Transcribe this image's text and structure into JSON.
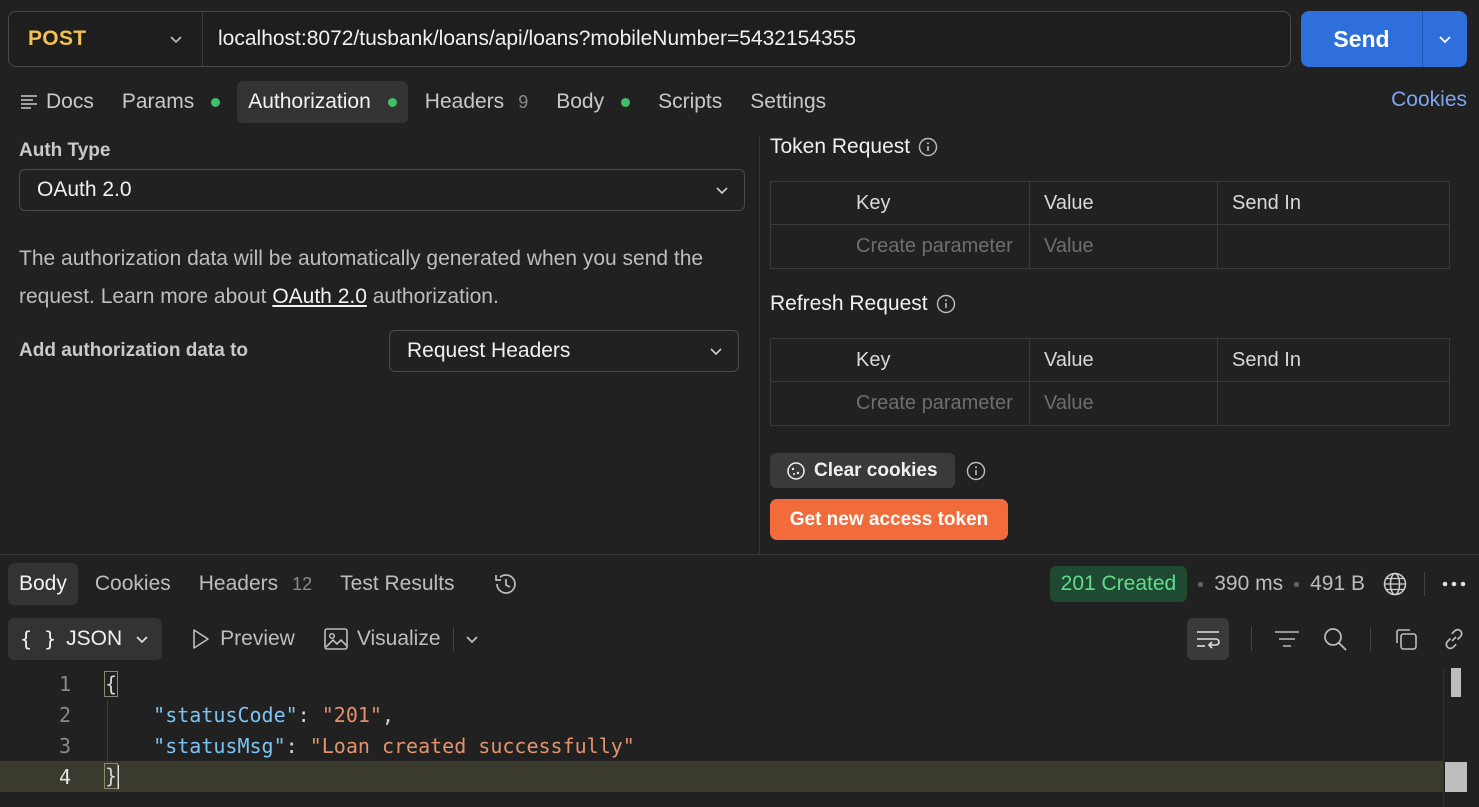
{
  "request": {
    "method": "POST",
    "url": "localhost:8072/tusbank/loans/api/loans?mobileNumber=5432154355",
    "send_label": "Send"
  },
  "tabs": [
    {
      "label": "Docs"
    },
    {
      "label": "Params"
    },
    {
      "label": "Authorization"
    },
    {
      "label": "Headers",
      "count": "9"
    },
    {
      "label": "Body"
    },
    {
      "label": "Scripts"
    },
    {
      "label": "Settings"
    }
  ],
  "cookies_link": "Cookies",
  "auth": {
    "type_label": "Auth Type",
    "type_value": "OAuth 2.0",
    "desc_before": "The authorization data will be automatically generated when you send the request. Learn more about ",
    "desc_link": "OAuth 2.0",
    "desc_after": " authorization.",
    "add_label": "Add authorization data to",
    "add_value": "Request Headers"
  },
  "token_request": {
    "title": "Token Request",
    "headers": [
      "Key",
      "Value",
      "Send In"
    ],
    "placeholders": [
      "Create parameter",
      "Value",
      ""
    ]
  },
  "refresh_request": {
    "title": "Refresh Request",
    "headers": [
      "Key",
      "Value",
      "Send In"
    ],
    "placeholders": [
      "Create parameter",
      "Value",
      ""
    ]
  },
  "clear_cookies": "Clear cookies",
  "get_token": "Get new access token",
  "response": {
    "tabs": [
      {
        "label": "Body"
      },
      {
        "label": "Cookies"
      },
      {
        "label": "Headers",
        "count": "12"
      },
      {
        "label": "Test Results"
      }
    ],
    "status": "201 Created",
    "time": "390 ms",
    "size": "491 B",
    "format": "JSON",
    "preview": "Preview",
    "visualize": "Visualize",
    "lines": [
      {
        "n": "1"
      },
      {
        "n": "2",
        "key": "\"statusCode\"",
        "value": "\"201\""
      },
      {
        "n": "3",
        "key": "\"statusMsg\"",
        "value": "\"Loan created successfully\""
      },
      {
        "n": "4"
      }
    ]
  },
  "colors": {
    "accent": "#2f6fdb",
    "method": "#f2c14e",
    "token_button": "#f26b3a",
    "status_ok": "#5fdd8c"
  }
}
